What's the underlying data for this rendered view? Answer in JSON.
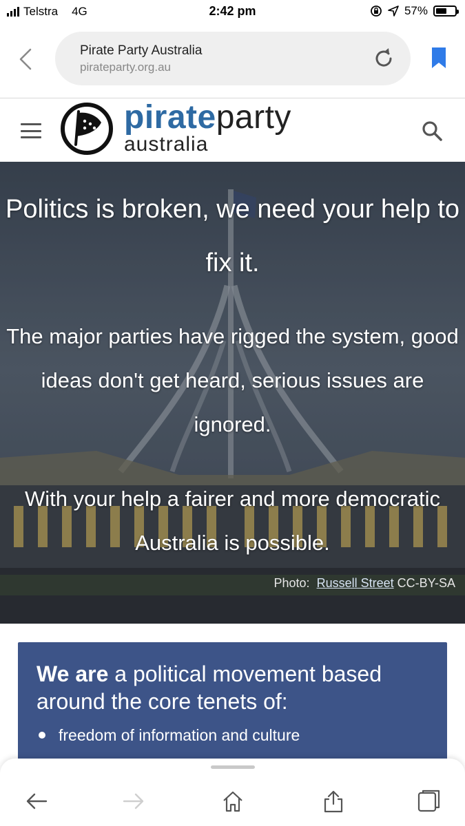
{
  "status_bar": {
    "carrier": "Telstra",
    "network": "4G",
    "time": "2:42 pm",
    "battery": "57%",
    "battery_level": 0.57
  },
  "browser": {
    "page_title": "Pirate Party Australia",
    "host": "pirateparty.org.au",
    "icons": {
      "back": "chevron-left-icon",
      "reload": "reload-icon",
      "bookmark": "bookmark-icon"
    },
    "accent_color": "#2f7be8"
  },
  "site_header": {
    "brand_pirate": "pirate",
    "brand_party": "party",
    "brand_sub": "australia",
    "brand_color": "#2e6aa3",
    "icons": {
      "menu": "hamburger-menu-icon",
      "logo": "pirate-sail-logo-icon",
      "search": "search-icon"
    }
  },
  "hero": {
    "headline": "Politics is broken, we need your help to fix it.",
    "paragraph_1": "The major parties have rigged the system, good ideas don't get heard, serious issues are ignored.",
    "paragraph_2": "With your help a fairer and more democratic Australia is possible.",
    "credit_prefix": "Photo:",
    "credit_link": "Russell Street",
    "credit_license": "CC-BY-SA"
  },
  "about_card": {
    "heading_bold": "We are",
    "heading_rest": "a political movement based around the core tenets of:",
    "items": [
      "freedom of information and culture"
    ],
    "background_color": "#3d5488"
  },
  "toolbar": {
    "icons": [
      "back-arrow-icon",
      "forward-arrow-icon",
      "home-icon",
      "share-icon",
      "tabs-icon"
    ]
  }
}
